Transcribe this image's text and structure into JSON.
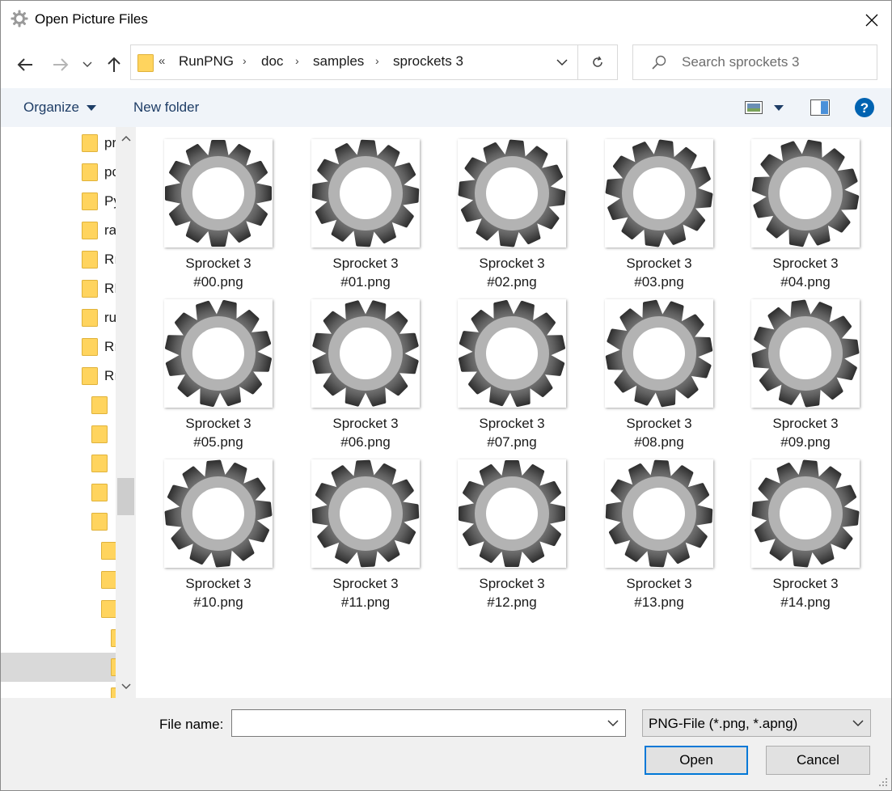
{
  "window": {
    "title": "Open Picture Files"
  },
  "nav": {
    "breadcrumb_overflow": "«",
    "breadcrumbs": [
      "RunPNG",
      "doc",
      "samples",
      "sprockets 3"
    ],
    "search_placeholder": "Search sprockets 3"
  },
  "toolbar": {
    "organize_label": "Organize",
    "new_folder_label": "New folder"
  },
  "tree": {
    "items": [
      {
        "label": "pr"
      },
      {
        "label": "pc"
      },
      {
        "label": "Py"
      },
      {
        "label": "ra"
      },
      {
        "label": "Rı"
      },
      {
        "label": "RI"
      },
      {
        "label": "ru"
      },
      {
        "label": "Rı"
      },
      {
        "label": "Rı"
      },
      {
        "label": ""
      },
      {
        "label": ""
      },
      {
        "label": ""
      },
      {
        "label": ""
      },
      {
        "label": ""
      },
      {
        "label": ""
      },
      {
        "label": ""
      },
      {
        "label": ""
      },
      {
        "label": ""
      },
      {
        "label": ""
      },
      {
        "label": ""
      }
    ]
  },
  "files": [
    {
      "line1": "Sprocket 3",
      "line2": "#00.png"
    },
    {
      "line1": "Sprocket 3",
      "line2": "#01.png"
    },
    {
      "line1": "Sprocket 3",
      "line2": "#02.png"
    },
    {
      "line1": "Sprocket 3",
      "line2": "#03.png"
    },
    {
      "line1": "Sprocket 3",
      "line2": "#04.png"
    },
    {
      "line1": "Sprocket 3",
      "line2": "#05.png"
    },
    {
      "line1": "Sprocket 3",
      "line2": "#06.png"
    },
    {
      "line1": "Sprocket 3",
      "line2": "#07.png"
    },
    {
      "line1": "Sprocket 3",
      "line2": "#08.png"
    },
    {
      "line1": "Sprocket 3",
      "line2": "#09.png"
    },
    {
      "line1": "Sprocket 3",
      "line2": "#10.png"
    },
    {
      "line1": "Sprocket 3",
      "line2": "#11.png"
    },
    {
      "line1": "Sprocket 3",
      "line2": "#12.png"
    },
    {
      "line1": "Sprocket 3",
      "line2": "#13.png"
    },
    {
      "line1": "Sprocket 3",
      "line2": "#14.png"
    }
  ],
  "footer": {
    "file_name_label": "File name:",
    "file_name_value": "",
    "file_type_selected": "PNG-File (*.png, *.apng)",
    "open_label": "Open",
    "cancel_label": "Cancel"
  },
  "colors": {
    "accent": "#0078d7",
    "folder": "#ffd45e",
    "command_text": "#1e3d66"
  }
}
